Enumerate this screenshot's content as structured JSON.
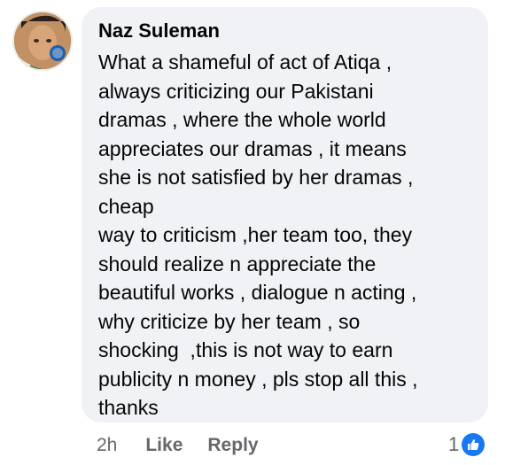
{
  "comment": {
    "author": "Naz Suleman",
    "text_lines": [
      "What a shameful of act of Atiqa ,",
      "always criticizing our Pakistani",
      "dramas , where the whole world",
      "appreciates our dramas , it means",
      "she is not satisfied by her dramas ,",
      "cheap",
      "way to criticism ,her team too, they",
      "should realize n appreciate the",
      "beautiful works , dialogue n acting ,",
      "why criticize by her team , so",
      "shocking  ,this is not way to earn",
      "publicity n money , pls stop all this ,",
      "thanks"
    ],
    "timestamp": "2h",
    "like_label": "Like",
    "reply_label": "Reply",
    "reaction_count": "1",
    "reaction_icon": "thumbs-up-icon"
  },
  "colors": {
    "bubble_bg": "#f0f2f5",
    "text": "#050505",
    "meta_text": "#65676b",
    "like_blue": "#1877f2"
  }
}
